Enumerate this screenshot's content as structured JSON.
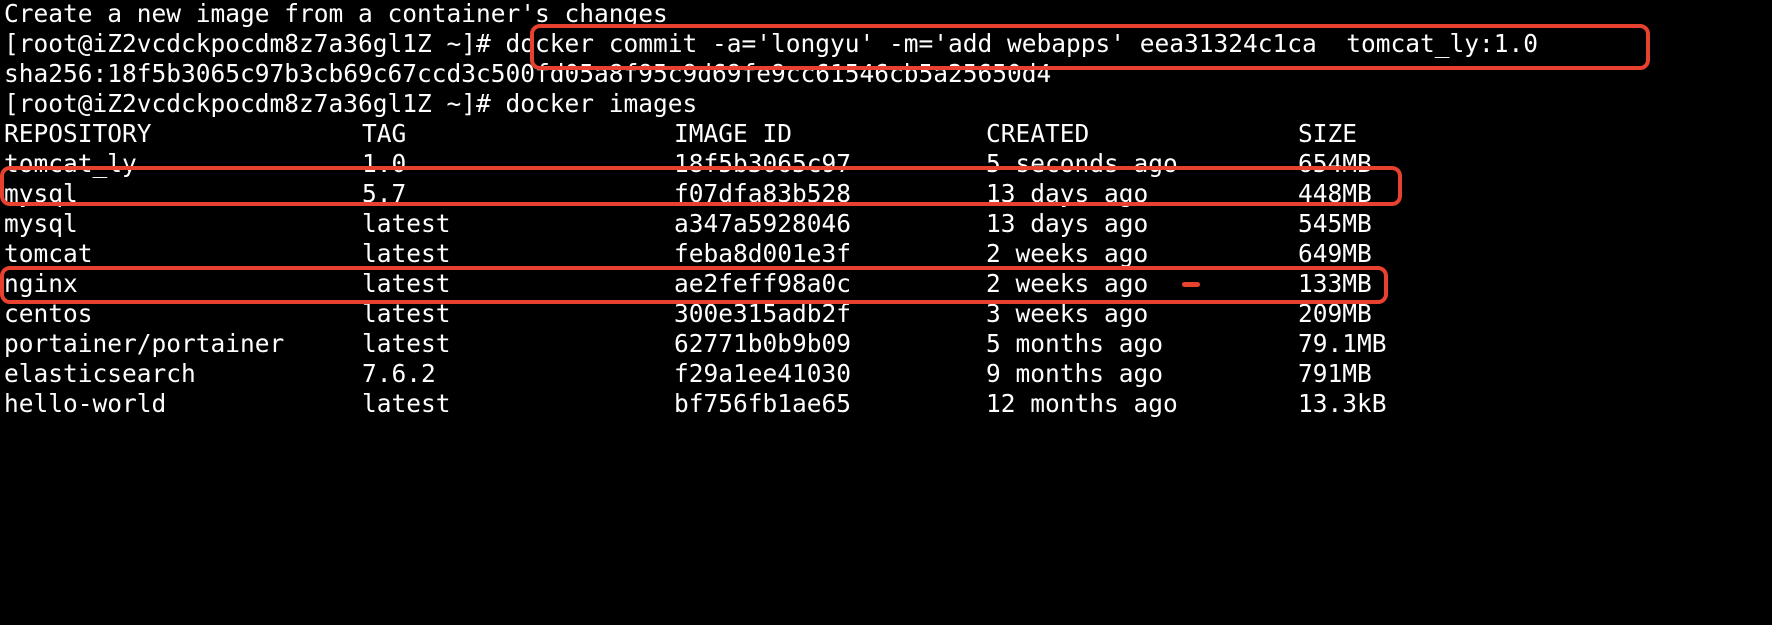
{
  "terminal": {
    "lines": {
      "l1": "Create a new image from a container's changes",
      "l2_prompt": "[root@iZ2vcdckpocdm8z7a36gl1Z ~]# ",
      "l2_command": "docker commit -a='longyu' -m='add webapps' eea31324c1ca  tomcat_ly:1.0",
      "l3": "sha256:18f5b3065c97b3cb69c67ccd3c500fd05a8f95c9d69fe9cc61546cb5a25650d4",
      "l4_prompt": "[root@iZ2vcdckpocdm8z7a36gl1Z ~]# ",
      "l4_command": "docker images"
    },
    "table": {
      "headers": [
        "REPOSITORY",
        "TAG",
        "IMAGE ID",
        "CREATED",
        "SIZE"
      ],
      "rows": [
        {
          "repository": "tomcat_ly",
          "tag": "1.0",
          "image_id": "18f5b3065c97",
          "created": "5 seconds ago",
          "size": "654MB"
        },
        {
          "repository": "mysql",
          "tag": "5.7",
          "image_id": "f07dfa83b528",
          "created": "13 days ago",
          "size": "448MB"
        },
        {
          "repository": "mysql",
          "tag": "latest",
          "image_id": "a347a5928046",
          "created": "13 days ago",
          "size": "545MB"
        },
        {
          "repository": "tomcat",
          "tag": "latest",
          "image_id": "feba8d001e3f",
          "created": "2 weeks ago",
          "size": "649MB"
        },
        {
          "repository": "nginx",
          "tag": "latest",
          "image_id": "ae2feff98a0c",
          "created": "2 weeks ago",
          "size": "133MB"
        },
        {
          "repository": "centos",
          "tag": "latest",
          "image_id": "300e315adb2f",
          "created": "3 weeks ago",
          "size": "209MB"
        },
        {
          "repository": "portainer/portainer",
          "tag": "latest",
          "image_id": "62771b0b9b09",
          "created": "5 months ago",
          "size": "79.1MB"
        },
        {
          "repository": "elasticsearch",
          "tag": "7.6.2",
          "image_id": "f29a1ee41030",
          "created": "9 months ago",
          "size": "791MB"
        },
        {
          "repository": "hello-world",
          "tag": "latest",
          "image_id": "bf756fb1ae65",
          "created": "12 months ago",
          "size": "13.3kB"
        }
      ]
    }
  },
  "colors": {
    "background": "#000000",
    "text": "#ffffff",
    "highlight": "#e8412f"
  }
}
